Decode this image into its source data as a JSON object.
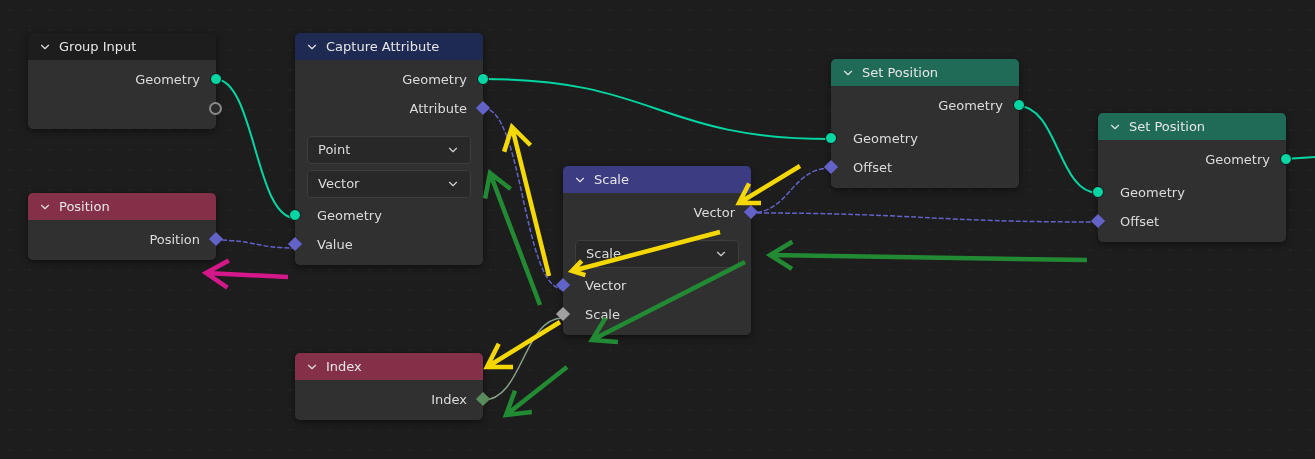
{
  "nodes": [
    {
      "title": "Group Input",
      "color": "#1d1d1d",
      "rows": [
        {
          "kind": "output",
          "label": "Geometry",
          "socket": {
            "kind": "circle",
            "color": "#00d6a3"
          }
        },
        {
          "kind": "output",
          "socket": {
            "kind": "hollow",
            "color": "#8a8a8a"
          }
        }
      ]
    },
    {
      "title": "Position",
      "color": "#843049",
      "rows": [
        {
          "kind": "output",
          "label": "Position",
          "socket": {
            "kind": "diamond",
            "color": "#6363c7"
          }
        }
      ]
    },
    {
      "title": "Capture Attribute",
      "color": "#1e2a52",
      "rows": [
        {
          "kind": "output",
          "label": "Geometry",
          "socket": {
            "kind": "circle",
            "color": "#00d6a3"
          }
        },
        {
          "kind": "output",
          "label": "Attribute",
          "socket": {
            "kind": "diamond",
            "color": "#6363c7"
          }
        },
        {
          "kind": "dropdown",
          "label": "Point"
        },
        {
          "kind": "dropdown",
          "label": "Vector"
        },
        {
          "kind": "input",
          "label": "Geometry",
          "socket": {
            "kind": "circle",
            "color": "#00d6a3"
          }
        },
        {
          "kind": "input",
          "label": "Value",
          "socket": {
            "kind": "diamond",
            "color": "#6363c7"
          }
        }
      ]
    },
    {
      "title": "Scale",
      "color": "#3c3c83",
      "rows": [
        {
          "kind": "output",
          "label": "Vector",
          "socket": {
            "kind": "diamond",
            "color": "#6363c7"
          }
        },
        {
          "kind": "dropdown",
          "label": "Scale"
        },
        {
          "kind": "input",
          "label": "Vector",
          "socket": {
            "kind": "diamond",
            "color": "#6363c7"
          }
        },
        {
          "kind": "input",
          "label": "Scale",
          "socket": {
            "kind": "diamond",
            "color": "#a1a1a1"
          }
        }
      ]
    },
    {
      "title": "Index",
      "color": "#843049",
      "rows": [
        {
          "kind": "output",
          "label": "Index",
          "socket": {
            "kind": "diamond",
            "color": "#598c5c"
          }
        }
      ]
    },
    {
      "title": "Set Position",
      "color": "#1f6b58",
      "rows": [
        {
          "kind": "output",
          "label": "Geometry",
          "socket": {
            "kind": "circle",
            "color": "#00d6a3"
          }
        },
        {
          "kind": "input",
          "label": "Geometry",
          "socket": {
            "kind": "circle",
            "color": "#00d6a3"
          }
        },
        {
          "kind": "input",
          "label": "Offset",
          "socket": {
            "kind": "diamond",
            "color": "#6363c7"
          }
        }
      ]
    },
    {
      "title": "Set Position",
      "color": "#1f6b58",
      "rows": [
        {
          "kind": "output",
          "label": "Geometry",
          "socket": {
            "kind": "circle",
            "color": "#00d6a3"
          }
        },
        {
          "kind": "input",
          "label": "Geometry",
          "socket": {
            "kind": "circle",
            "color": "#00d6a3"
          }
        },
        {
          "kind": "input",
          "label": "Offset",
          "socket": {
            "kind": "diamond",
            "color": "#6363c7"
          }
        }
      ]
    }
  ]
}
